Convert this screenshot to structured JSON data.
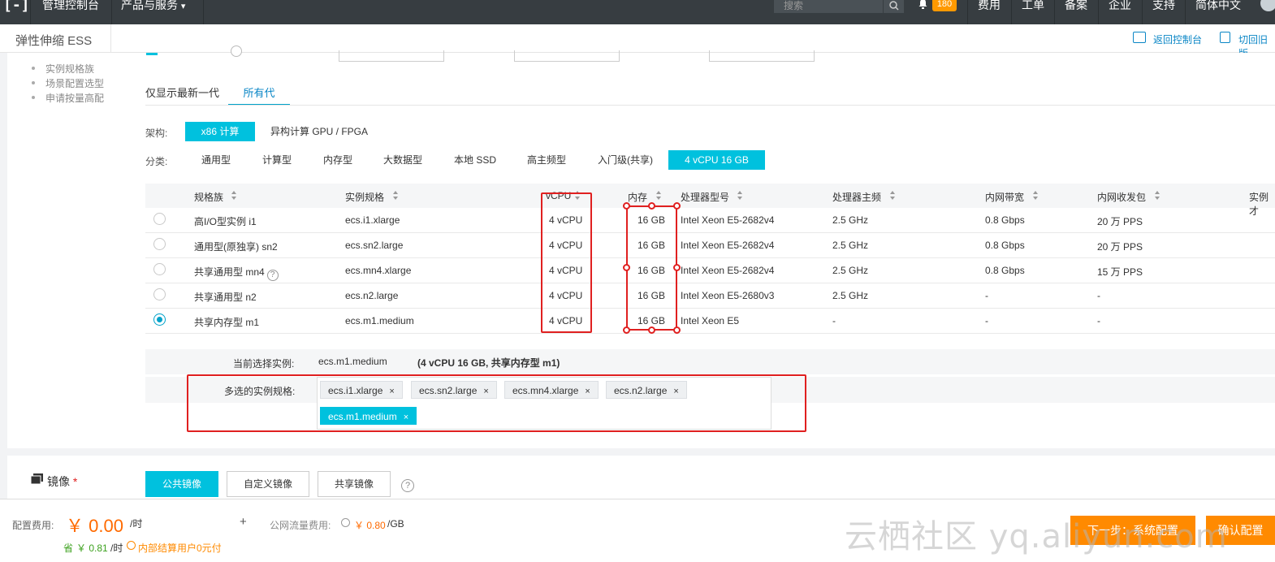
{
  "topbar": {
    "logo_glyph": "[-]",
    "console": "管理控制台",
    "products": "产品与服务",
    "products_caret": "▾",
    "search_placeholder": "搜索",
    "notify_count": "180",
    "links": [
      "费用",
      "工单",
      "备案",
      "企业",
      "支持",
      "简体中文"
    ]
  },
  "subbar": {
    "title": "弹性伸缩 ESS",
    "back_console": "返回控制台",
    "switch_old": "切回旧版"
  },
  "side_bullets": [
    "实例规格族",
    "场景配置选型",
    "申请按量高配"
  ],
  "generation_tabs": [
    "仅显示最新一代",
    "所有代"
  ],
  "arch": {
    "label": "架构:",
    "options": [
      "x86 计算",
      "异构计算 GPU / FPGA"
    ]
  },
  "category": {
    "label": "分类:",
    "options": [
      "通用型",
      "计算型",
      "内存型",
      "大数据型",
      "本地 SSD",
      "高主频型",
      "入门级(共享)",
      "4 vCPU 16 GB"
    ]
  },
  "table": {
    "headers": [
      "规格族",
      "实例规格",
      "vCPU",
      "内存",
      "处理器型号",
      "处理器主频",
      "内网带宽",
      "内网收发包",
      "实例才"
    ],
    "rows": [
      {
        "family": "高I/O型实例 i1",
        "spec": "ecs.i1.xlarge",
        "vcpu": "4 vCPU",
        "mem": "16 GB",
        "cpu_model": "Intel Xeon E5-2682v4",
        "freq": "2.5 GHz",
        "bandwidth": "0.8 Gbps",
        "pps": "20 万 PPS"
      },
      {
        "family": "通用型(原独享) sn2",
        "spec": "ecs.sn2.large",
        "vcpu": "4 vCPU",
        "mem": "16 GB",
        "cpu_model": "Intel Xeon E5-2682v4",
        "freq": "2.5 GHz",
        "bandwidth": "0.8 Gbps",
        "pps": "20 万 PPS"
      },
      {
        "family": "共享通用型 mn4",
        "spec": "ecs.mn4.xlarge",
        "vcpu": "4 vCPU",
        "mem": "16 GB",
        "cpu_model": "Intel Xeon E5-2682v4",
        "freq": "2.5 GHz",
        "bandwidth": "0.8 Gbps",
        "pps": "15 万 PPS"
      },
      {
        "family": "共享通用型 n2",
        "spec": "ecs.n2.large",
        "vcpu": "4 vCPU",
        "mem": "16 GB",
        "cpu_model": "Intel Xeon E5-2680v3",
        "freq": "2.5 GHz",
        "bandwidth": "-",
        "pps": "-"
      },
      {
        "family": "共享内存型 m1",
        "spec": "ecs.m1.medium",
        "vcpu": "4 vCPU",
        "mem": "16 GB",
        "cpu_model": "Intel Xeon E5",
        "freq": "-",
        "bandwidth": "-",
        "pps": "-"
      }
    ],
    "selected_row": 4,
    "help_mark": "?"
  },
  "selection": {
    "current_label": "当前选择实例:",
    "current_value": "ecs.m1.medium",
    "current_detail": "(4 vCPU 16 GB, 共享内存型 m1)",
    "multi_label": "多选的实例规格:",
    "tags": [
      "ecs.i1.xlarge",
      "ecs.sn2.large",
      "ecs.mn4.xlarge",
      "ecs.n2.large",
      "ecs.m1.medium"
    ],
    "tag_close": "×"
  },
  "image": {
    "label": "镜像",
    "required_mark": "*",
    "tabs": [
      "公共镜像",
      "自定义镜像",
      "共享镜像"
    ],
    "help_mark": "?"
  },
  "footer": {
    "cost_label": "配置费用:",
    "cost_value": "￥ 0.00",
    "cost_unit": "/时",
    "plus": "+",
    "traffic_label": "公网流量费用:",
    "traffic_value": "￥ 0.80",
    "traffic_unit": "/GB",
    "save_prefix": "省",
    "save_value": "￥ 0.81",
    "save_unit": "/时",
    "internal_note": "内部结算用户0元付",
    "next_button": "下一步：系统配置",
    "confirm_button": "确认配置"
  },
  "watermark": "云栖社区 yq.aliyun.com",
  "colors": {
    "accent": "#00c1de",
    "link": "#0a86c6",
    "orange": "#ff8a00",
    "annotation_red": "#e02020",
    "green": "#3ca11e"
  }
}
